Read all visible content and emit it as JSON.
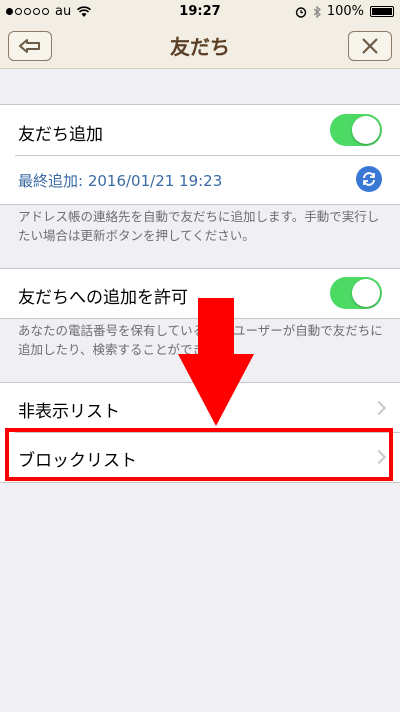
{
  "status_bar": {
    "carrier": "au",
    "time": "19:27",
    "battery": "100%"
  },
  "nav": {
    "title": "友だち",
    "back_icon": "back-arrow-icon",
    "close_icon": "close-icon"
  },
  "auto_add": {
    "label": "友だち追加",
    "toggle_on": true,
    "last_added": "最終追加: 2016/01/21 19:23",
    "footnote": "アドレス帳の連絡先を自動で友だちに追加します。手動で実行したい場合は更新ボタンを押してください。"
  },
  "allow_add": {
    "label": "友だちへの追加を許可",
    "toggle_on": true,
    "footnote": "あなたの電話番号を保有しているLINEユーザーが自動で友だちに追加したり、検索することができます。"
  },
  "lists": {
    "hidden": "非表示リスト",
    "blocked": "ブロックリスト"
  },
  "colors": {
    "toggle_on": "#4cd964",
    "annotation": "#ff0000",
    "link_blue": "#3a6aa4"
  }
}
